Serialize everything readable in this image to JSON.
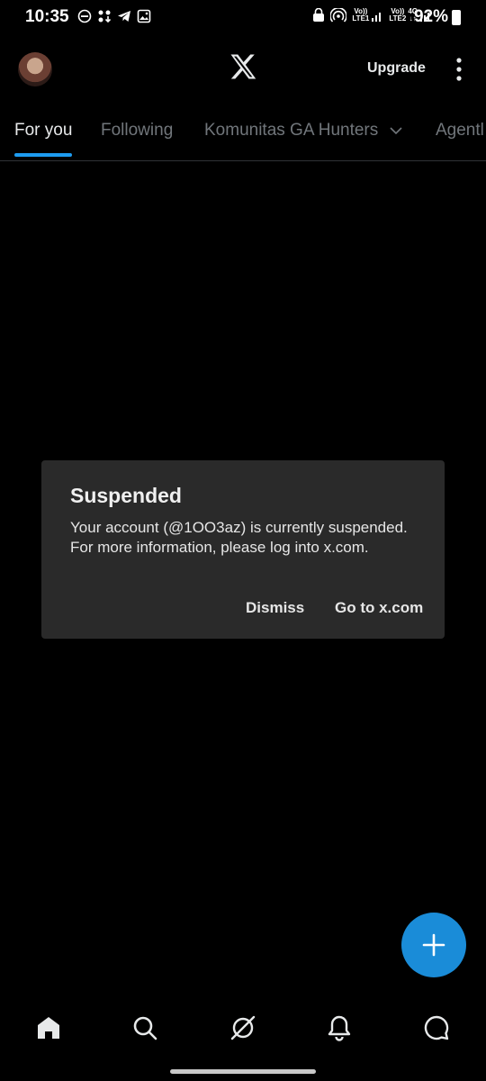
{
  "status_bar": {
    "time": "10:35",
    "sim1_label": "LTE1",
    "sim2_label": "LTE2",
    "network_type": "4G",
    "battery_percent": "92%"
  },
  "header": {
    "upgrade_label": "Upgrade",
    "logo_icon": "x-logo-icon",
    "more_icon": "more-vertical-icon"
  },
  "tabs": [
    {
      "label": "For you",
      "active": true
    },
    {
      "label": "Following",
      "active": false
    },
    {
      "label": "Komunitas GA Hunters",
      "active": false,
      "has_dropdown": true
    },
    {
      "label": "Agentl",
      "active": false
    }
  ],
  "dialog": {
    "title": "Suspended",
    "message": "Your account (@1OO3az) is currently suspended. For more information, please log into x.com.",
    "dismiss_label": "Dismiss",
    "go_label": "Go to x.com"
  },
  "fab": {
    "icon": "plus-icon"
  },
  "bottom_nav": [
    "home-icon",
    "search-icon",
    "grok-icon",
    "notifications-icon",
    "messages-icon"
  ],
  "colors": {
    "accent": "#1d9bf0",
    "fab": "#1a8cd8",
    "dialog_bg": "#2a2a2a",
    "background": "#000000"
  }
}
